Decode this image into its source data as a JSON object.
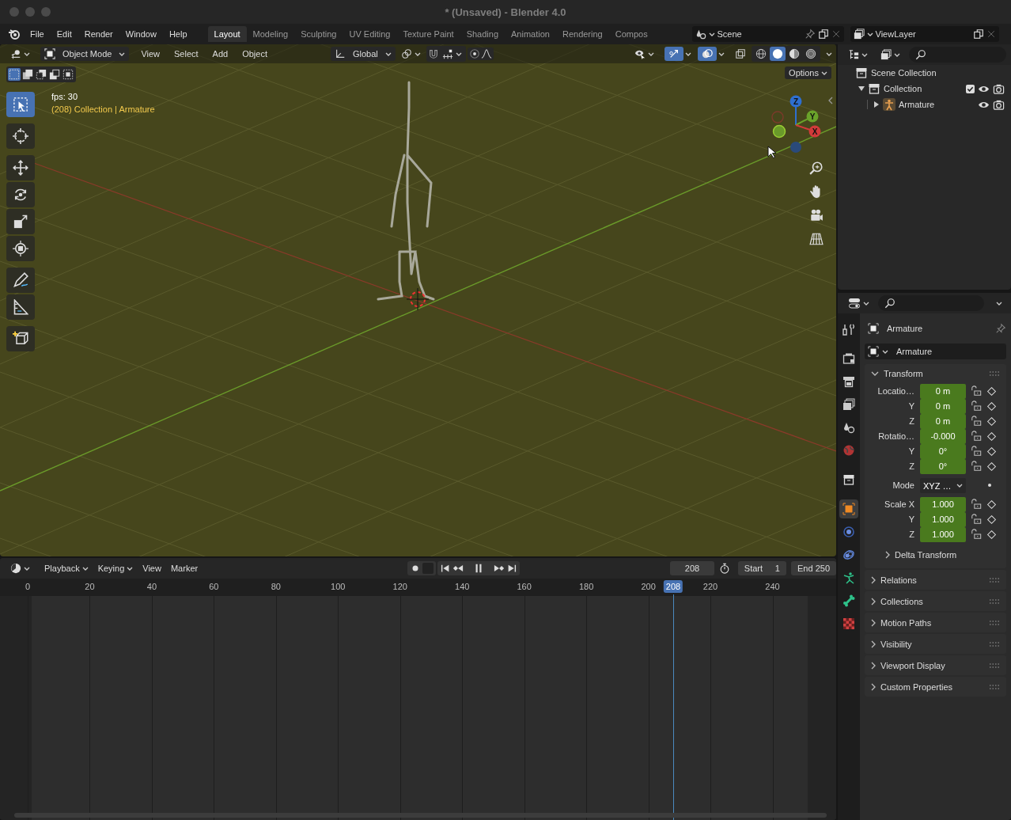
{
  "window": {
    "title": "* (Unsaved) - Blender 4.0"
  },
  "menu": [
    "File",
    "Edit",
    "Render",
    "Window",
    "Help"
  ],
  "workspaces": [
    {
      "label": "Layout",
      "selected": true
    },
    {
      "label": "Modeling",
      "selected": false
    },
    {
      "label": "Sculpting",
      "selected": false
    },
    {
      "label": "UV Editing",
      "selected": false
    },
    {
      "label": "Texture Paint",
      "selected": false
    },
    {
      "label": "Shading",
      "selected": false
    },
    {
      "label": "Animation",
      "selected": false
    },
    {
      "label": "Rendering",
      "selected": false
    },
    {
      "label": "Compos",
      "selected": false
    }
  ],
  "scene": {
    "name": "Scene"
  },
  "view_layer": {
    "name": "ViewLayer"
  },
  "viewport": {
    "mode": "Object Mode",
    "menus": [
      "View",
      "Select",
      "Add",
      "Object"
    ],
    "orientation": "Global",
    "toggles": [
      {
        "kind": "gizmos",
        "on": true
      },
      {
        "kind": "overlays",
        "on": true
      },
      {
        "kind": "xray",
        "on": false
      }
    ],
    "shading": [
      {
        "kind": "wireframe",
        "selected": false
      },
      {
        "kind": "solid",
        "selected": true
      },
      {
        "kind": "material",
        "selected": false
      },
      {
        "kind": "rendered",
        "selected": false
      }
    ],
    "select_modes": [
      {
        "kind": "new",
        "selected": true
      },
      {
        "kind": "extend",
        "selected": false
      },
      {
        "kind": "subtract",
        "selected": false
      },
      {
        "kind": "invert",
        "selected": false
      },
      {
        "kind": "intersect",
        "selected": false
      }
    ],
    "options": "Options",
    "fps": "fps: 30",
    "info": "(208) Collection | Armature",
    "tools": [
      {
        "kind": "select_box",
        "selected": true
      },
      {
        "kind": "cursor",
        "selected": false
      },
      {
        "kind": "move",
        "selected": false
      },
      {
        "kind": "rotate",
        "selected": false
      },
      {
        "kind": "scale",
        "selected": false
      },
      {
        "kind": "transform",
        "selected": false
      },
      {
        "kind": "annotate",
        "selected": false
      },
      {
        "kind": "measure",
        "selected": false
      },
      {
        "kind": "add_cube",
        "selected": false
      }
    ],
    "gizmo": [
      "Z",
      "Y",
      "X"
    ]
  },
  "outliner": {
    "items": [
      {
        "kind": "scene_collection",
        "label": "Scene Collection",
        "children": [
          {
            "kind": "collection",
            "label": "Collection",
            "expanded": true,
            "checked": true,
            "children": [
              {
                "kind": "armature",
                "label": "Armature",
                "expanded": false
              }
            ]
          }
        ]
      }
    ]
  },
  "properties": {
    "tabs": [
      {
        "kind": "tool",
        "selected": false
      },
      {
        "kind": "render",
        "selected": false
      },
      {
        "kind": "output",
        "selected": false
      },
      {
        "kind": "view_layer",
        "selected": false
      },
      {
        "kind": "scene",
        "selected": false
      },
      {
        "kind": "world",
        "selected": false
      },
      {
        "kind": "collection",
        "selected": false
      },
      {
        "kind": "object",
        "selected": true
      },
      {
        "kind": "physics",
        "selected": false
      },
      {
        "kind": "constraints",
        "selected": false
      },
      {
        "kind": "armature_data",
        "selected": false
      },
      {
        "kind": "bone",
        "selected": false
      },
      {
        "kind": "texture",
        "selected": false
      }
    ],
    "object": "Armature",
    "data": "Armature",
    "transform": {
      "title": "Transform",
      "expanded": true,
      "rows": [
        {
          "kind": "number",
          "label": "Locatio…",
          "value": "0 m"
        },
        {
          "kind": "number",
          "label": "Y",
          "value": "0 m"
        },
        {
          "kind": "number",
          "label": "Z",
          "value": "0 m"
        },
        {
          "kind": "number",
          "label": "Rotatio…",
          "value": "-0.000"
        },
        {
          "kind": "number",
          "label": "Y",
          "value": "0°"
        },
        {
          "kind": "number",
          "label": "Z",
          "value": "0°"
        },
        {
          "kind": "select",
          "label": "Mode",
          "value": "XYZ …"
        },
        {
          "kind": "number",
          "label": "Scale X",
          "value": "1.000"
        },
        {
          "kind": "number",
          "label": "Y",
          "value": "1.000"
        },
        {
          "kind": "number",
          "label": "Z",
          "value": "1.000"
        }
      ]
    },
    "subpanel": {
      "title": "Delta Transform",
      "expanded": false
    },
    "panels": [
      {
        "title": "Relations",
        "expanded": false
      },
      {
        "title": "Collections",
        "expanded": false
      },
      {
        "title": "Motion Paths",
        "expanded": false
      },
      {
        "title": "Visibility",
        "expanded": false
      },
      {
        "title": "Viewport Display",
        "expanded": false
      },
      {
        "title": "Custom Properties",
        "expanded": false
      }
    ]
  },
  "timeline": {
    "menus": [
      "Playback",
      "Keying",
      "View",
      "Marker"
    ],
    "current_frame": "208",
    "start_label": "Start",
    "start": "1",
    "end_label": "End",
    "end": "250",
    "ticks": [
      "0",
      "20",
      "40",
      "60",
      "80",
      "100",
      "120",
      "140",
      "160",
      "180",
      "200",
      "220",
      "240"
    ],
    "playhead": "208"
  }
}
